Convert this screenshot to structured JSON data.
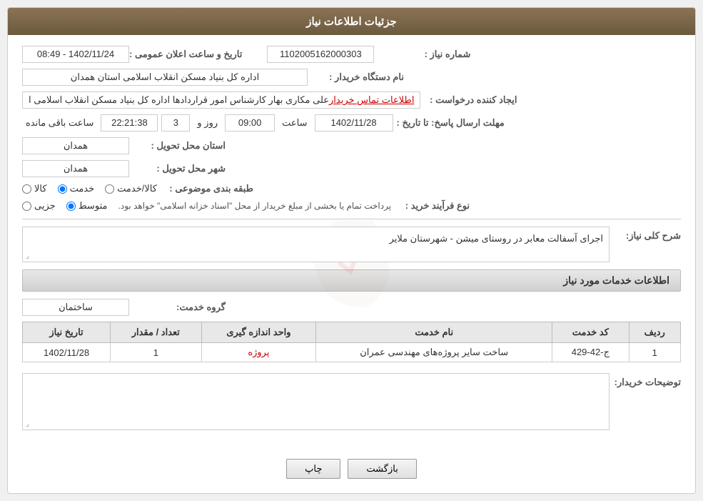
{
  "header": {
    "title": "جزئیات اطلاعات نیاز"
  },
  "fields": {
    "need_number_label": "شماره نیاز :",
    "need_number_value": "1102005162000303",
    "buyer_org_label": "نام دستگاه خریدار :",
    "buyer_org_value": "اداره کل بنیاد مسکن انقلاب اسلامی استان همدان",
    "creator_label": "ایجاد کننده درخواست :",
    "creator_value": "علی مکاری بهار کارشناس امور قراردادها اداره کل بنیاد مسکن انقلاب اسلامی ا",
    "contact_link": "اطلاعات تماس خریدار",
    "deadline_label": "مهلت ارسال پاسخ: تا تاریخ :",
    "deadline_date": "1402/11/28",
    "deadline_time_label": "ساعت",
    "deadline_time_value": "09:00",
    "deadline_days_label": "روز و",
    "deadline_days_value": "3",
    "deadline_remaining_label": "ساعت باقی مانده",
    "deadline_remaining_value": "22:21:38",
    "province_label": "استان محل تحویل :",
    "province_value": "همدان",
    "city_label": "شهر محل تحویل :",
    "city_value": "همدان",
    "category_label": "طبقه بندی موضوعی :",
    "category_options": [
      {
        "label": "کالا",
        "value": "kala"
      },
      {
        "label": "خدمت",
        "value": "khadamat"
      },
      {
        "label": "کالا/خدمت",
        "value": "kala_khadamat"
      }
    ],
    "category_selected": "khadamat",
    "process_label": "نوع فرآیند خرید :",
    "process_options": [
      {
        "label": "جزیی",
        "value": "jozi"
      },
      {
        "label": "متوسط",
        "value": "motevaset"
      }
    ],
    "process_selected": "motevaset",
    "process_note": "پرداخت تمام یا بخشی از مبلغ خریدار از محل \"اسناد خزانه اسلامی\" خواهد بود.",
    "announcement_label": "تاریخ و ساعت اعلان عمومی :",
    "announcement_value": "1402/11/24 - 08:49"
  },
  "description": {
    "section_title": "شرح کلی نیاز:",
    "value": "اجرای آسفالت معابر در روستای میشن - شهرستان ملایر"
  },
  "services_section": {
    "title": "اطلاعات خدمات مورد نیاز",
    "service_group_label": "گروه خدمت:",
    "service_group_value": "ساختمان",
    "table_headers": [
      "ردیف",
      "کد خدمت",
      "نام خدمت",
      "واحد اندازه گیری",
      "تعداد / مقدار",
      "تاریخ نیاز"
    ],
    "table_rows": [
      {
        "row": "1",
        "code": "ج-42-429",
        "name": "ساخت سایر پروژه‌های مهندسی عمران",
        "unit": "پروژه",
        "quantity": "1",
        "date": "1402/11/28"
      }
    ]
  },
  "buyer_description": {
    "label": "توضیحات خریدار:",
    "value": ""
  },
  "buttons": {
    "print_label": "چاپ",
    "back_label": "بازگشت"
  }
}
